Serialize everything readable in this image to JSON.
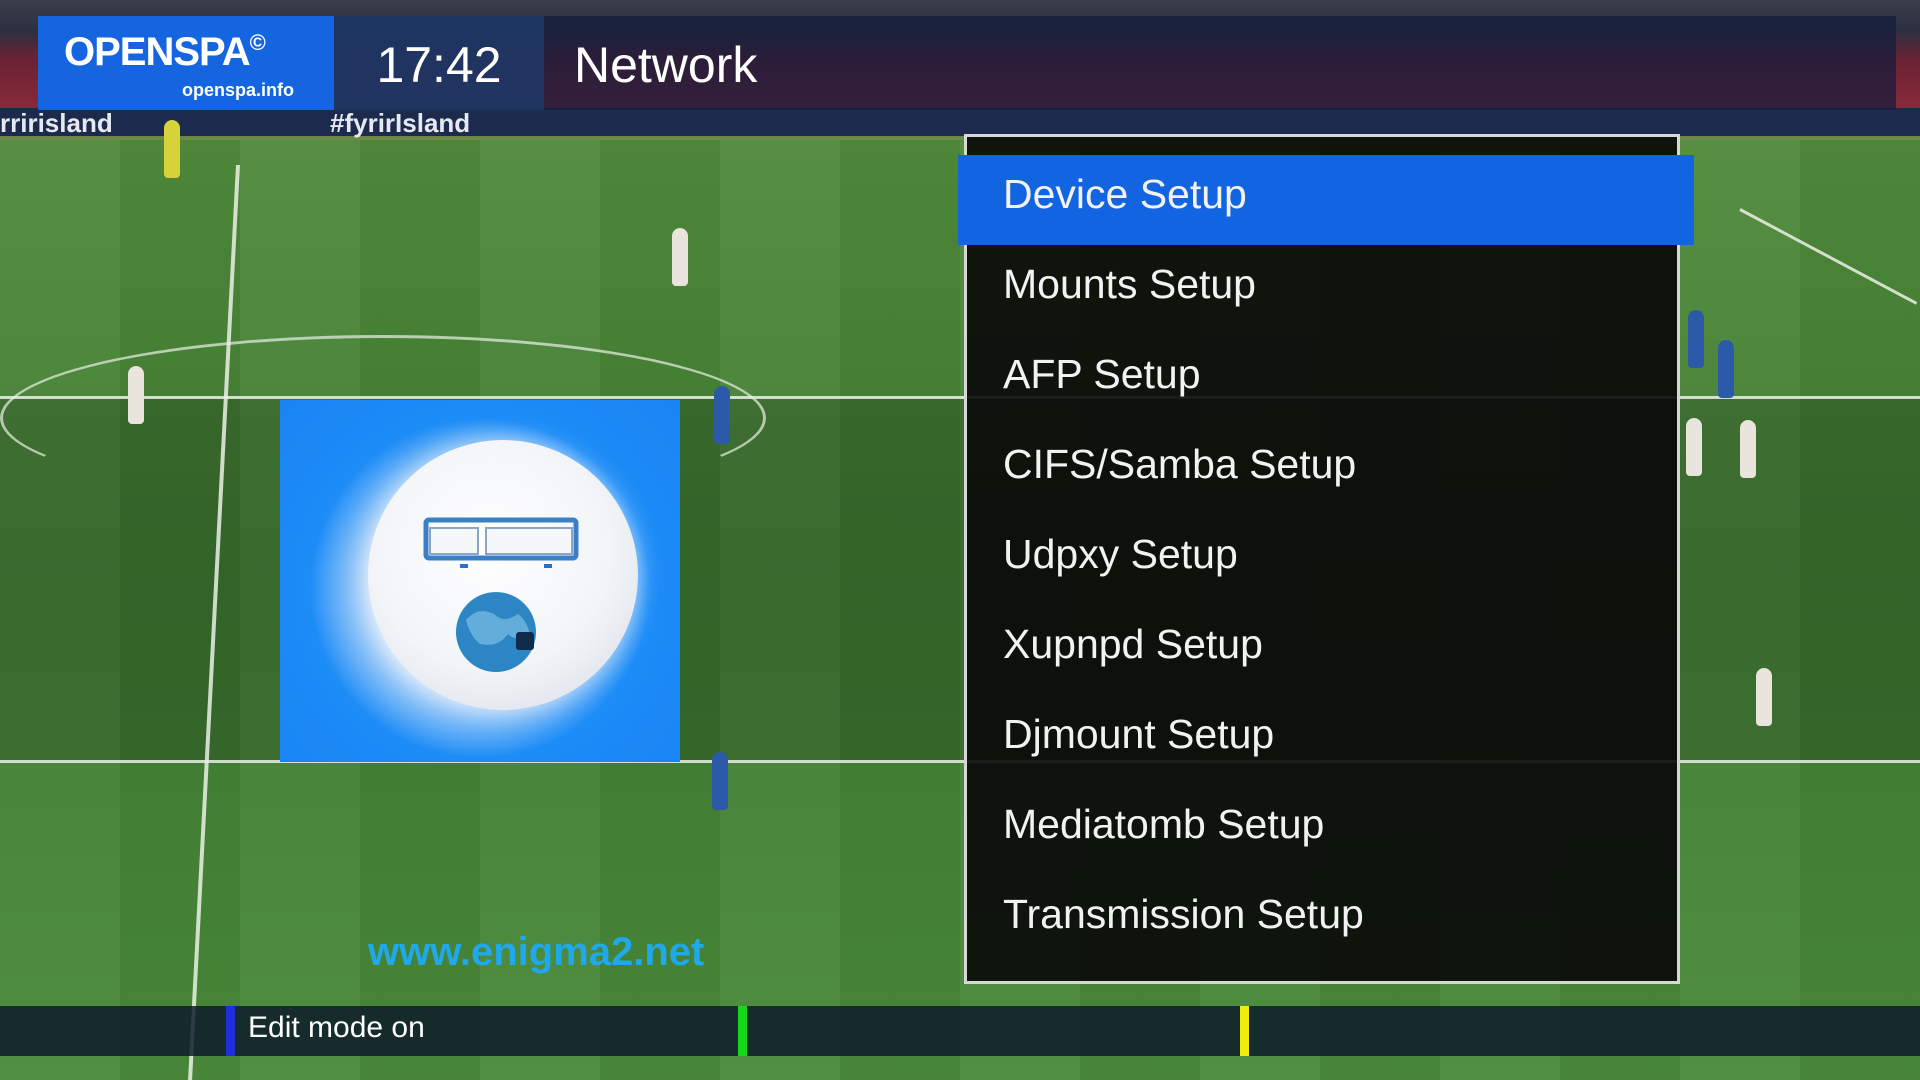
{
  "header": {
    "logo_main": "OPENSPA",
    "logo_mark": "©",
    "logo_sub": "openspa.info",
    "clock": "17:42",
    "title": "Network"
  },
  "background": {
    "board_text_left": "rririsland",
    "board_text": "#fyrirIsland"
  },
  "icon_panel": {
    "icon": "network-globe-icon"
  },
  "watermark": "www.enigma2.net",
  "menu": {
    "selected_index": 0,
    "items": [
      {
        "label": "Device Setup"
      },
      {
        "label": "Mounts Setup"
      },
      {
        "label": "AFP Setup"
      },
      {
        "label": "CIFS/Samba Setup"
      },
      {
        "label": "Udpxy Setup"
      },
      {
        "label": "Xupnpd Setup"
      },
      {
        "label": "Djmount Setup"
      },
      {
        "label": "Mediatomb Setup"
      },
      {
        "label": "Transmission Setup"
      }
    ]
  },
  "footer": {
    "blue_label": "Edit mode on",
    "colors": {
      "blue": "#1c2fd8",
      "green": "#16d81a",
      "yellow": "#f0ec10"
    }
  },
  "colors": {
    "accent": "#1364e0",
    "logo_bg": "#1565e0",
    "watermark": "#1fa8ea"
  }
}
